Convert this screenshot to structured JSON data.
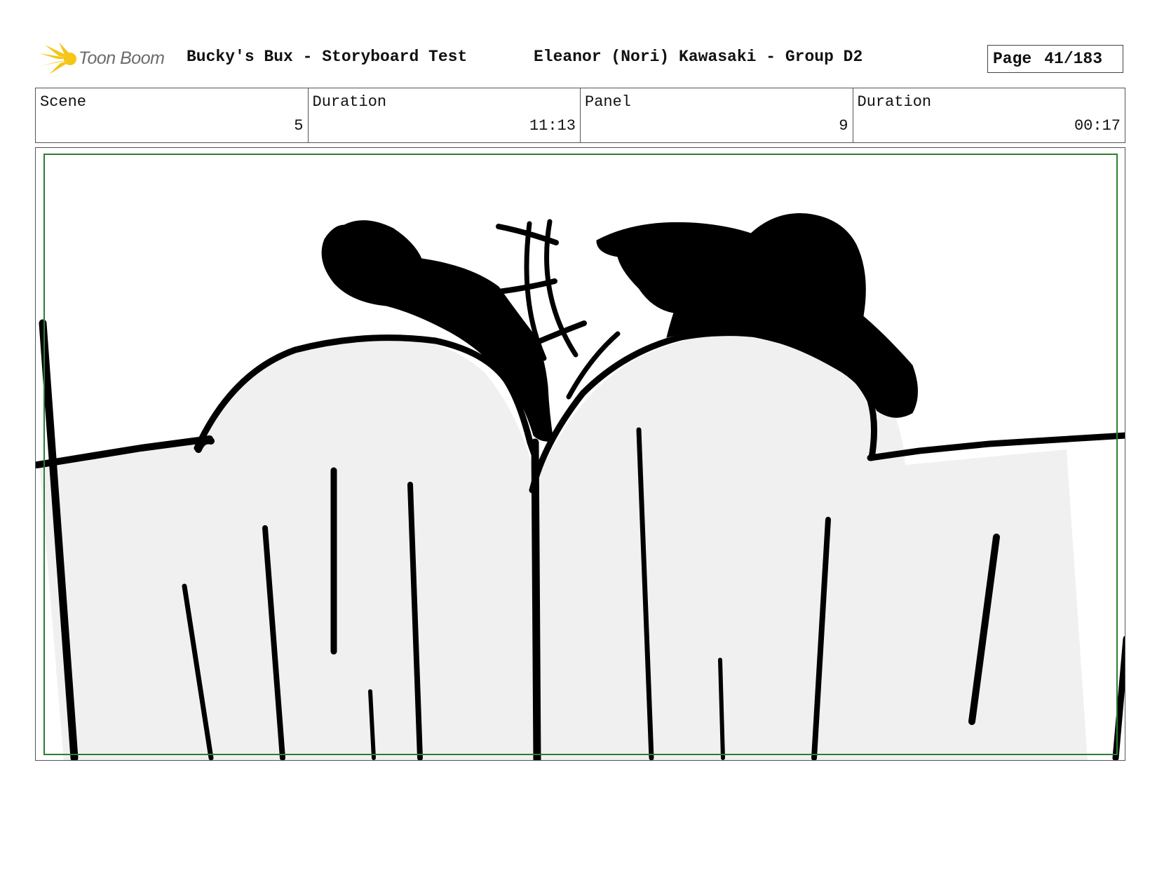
{
  "header": {
    "logo_text": "Toon Boom",
    "project_title": "Bucky's Bux - Storyboard Test",
    "artist_title": "Eleanor (Nori) Kawasaki - Group D2",
    "page_label": "Page",
    "page_number": "41/183"
  },
  "info": {
    "scene_label": "Scene",
    "scene_value": "5",
    "scene_duration_label": "Duration",
    "scene_duration_value": "11:13",
    "panel_label": "Panel",
    "panel_value": "9",
    "panel_duration_label": "Duration",
    "panel_duration_value": "00:17"
  },
  "colors": {
    "safe_frame": "#2e7d2e",
    "figure_fill": "#f0f0f0",
    "ink": "#000000",
    "logo_yellow": "#f5c518"
  }
}
